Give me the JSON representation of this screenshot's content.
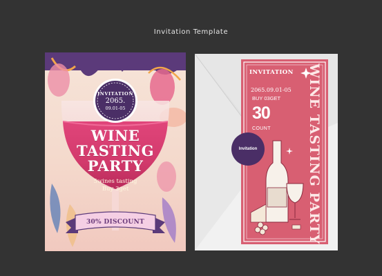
{
  "page": {
    "title": "Invitation Template"
  },
  "left_card": {
    "badge": {
      "label": "INVITATION",
      "year": "2065.",
      "date": "09.01-05"
    },
    "headline": [
      "WINE",
      "TASTING",
      "PARTY"
    ],
    "sub_line1": "5wines tasting",
    "sub_line2": "Buy 3get",
    "ribbon": "30% DISCOUNT"
  },
  "right_card": {
    "title": "INVITATION",
    "date": "2065.09.01-05",
    "buy": "BUY 03GET",
    "big_number": "30",
    "count_text": "COUNT",
    "vertical_title": "WINE TASTING PARTY",
    "seal_label": "Invitation"
  },
  "colors": {
    "background": "#333333",
    "wine_pink": "#d85f72",
    "purple": "#4a2e66",
    "envelope": "#f3f3f3"
  }
}
